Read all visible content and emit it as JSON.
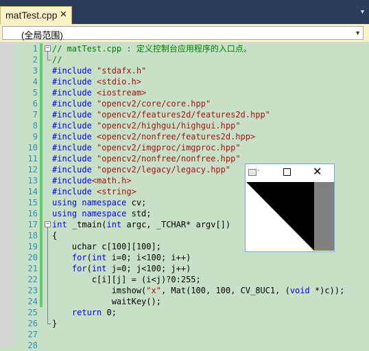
{
  "tab": {
    "title": "matTest.cpp",
    "close_glyph": "✕"
  },
  "scope": {
    "label": "(全局范围)"
  },
  "code_lines": [
    {
      "n": "1",
      "code": [
        [
          "cmt",
          "// matTest.cpp : 定义控制台应用程序的入口点。"
        ]
      ]
    },
    {
      "n": "2",
      "code": [
        [
          "cmt",
          "//"
        ]
      ]
    },
    {
      "n": "3",
      "code": [
        [
          "pp",
          "#include "
        ],
        [
          "str",
          "\"stdafx.h\""
        ]
      ]
    },
    {
      "n": "4",
      "code": [
        [
          "pp",
          "#include "
        ],
        [
          "str",
          "<stdio.h>"
        ]
      ]
    },
    {
      "n": "5",
      "code": [
        [
          "pp",
          "#include "
        ],
        [
          "str",
          "<iostream>"
        ]
      ]
    },
    {
      "n": "6",
      "code": [
        [
          "pp",
          "#include "
        ],
        [
          "str",
          "\"opencv2/core/core.hpp\""
        ]
      ]
    },
    {
      "n": "7",
      "code": [
        [
          "pp",
          "#include "
        ],
        [
          "str",
          "\"opencv2/features2d/features2d.hpp\""
        ]
      ]
    },
    {
      "n": "8",
      "code": [
        [
          "pp",
          "#include "
        ],
        [
          "str",
          "\"opencv2/highgui/highgui.hpp\""
        ]
      ]
    },
    {
      "n": "9",
      "code": [
        [
          "pp",
          "#include "
        ],
        [
          "str",
          "<opencv2/nonfree/features2d.hpp>"
        ]
      ]
    },
    {
      "n": "10",
      "code": [
        [
          "pp",
          "#include "
        ],
        [
          "str",
          "\"opencv2/imgproc/imgproc.hpp\""
        ]
      ]
    },
    {
      "n": "11",
      "code": [
        [
          "pp",
          "#include "
        ],
        [
          "str",
          "\"opencv2/nonfree/nonfree.hpp\""
        ]
      ]
    },
    {
      "n": "12",
      "code": [
        [
          "pp",
          "#include "
        ],
        [
          "str",
          "\"opencv2/legacy/legacy.hpp\""
        ]
      ]
    },
    {
      "n": "13",
      "code": [
        [
          "pp",
          "#include"
        ],
        [
          "str",
          "<math.h>"
        ]
      ]
    },
    {
      "n": "14",
      "code": [
        [
          "pp",
          "#include "
        ],
        [
          "str",
          "<string>"
        ]
      ]
    },
    {
      "n": "15",
      "code": [
        [
          "kw",
          "using namespace"
        ],
        [
          "txt",
          " cv;"
        ]
      ]
    },
    {
      "n": "16",
      "code": [
        [
          "kw",
          "using namespace"
        ],
        [
          "txt",
          " std;"
        ]
      ]
    },
    {
      "n": "17",
      "code": [
        [
          "kw",
          "int"
        ],
        [
          "txt",
          " _tmain("
        ],
        [
          "kw",
          "int"
        ],
        [
          "txt",
          " argc, _TCHAR* argv[])"
        ]
      ]
    },
    {
      "n": "18",
      "code": [
        [
          "txt",
          "{"
        ]
      ]
    },
    {
      "n": "19",
      "code": [
        [
          "txt",
          "    uchar c[100][100];"
        ]
      ]
    },
    {
      "n": "20",
      "code": [
        [
          "txt",
          "    "
        ],
        [
          "kw",
          "for"
        ],
        [
          "txt",
          "("
        ],
        [
          "kw",
          "int"
        ],
        [
          "txt",
          " i=0; i<100; i++)"
        ]
      ]
    },
    {
      "n": "21",
      "code": [
        [
          "txt",
          "    "
        ],
        [
          "kw",
          "for"
        ],
        [
          "txt",
          "("
        ],
        [
          "kw",
          "int"
        ],
        [
          "txt",
          " j=0; j<100; j++)"
        ]
      ]
    },
    {
      "n": "22",
      "code": [
        [
          "txt",
          "        c[i][j] = (i<j)?0:255;"
        ]
      ]
    },
    {
      "n": "23",
      "code": [
        [
          "txt",
          "            imshow("
        ],
        [
          "str",
          "\"x\""
        ],
        [
          "txt",
          ", Mat(100, 100, CV_8UC1, ("
        ],
        [
          "kw",
          "void"
        ],
        [
          "txt",
          " *)c));"
        ]
      ]
    },
    {
      "n": "24",
      "code": [
        [
          "txt",
          "            waitKey();"
        ]
      ]
    },
    {
      "n": "25",
      "code": [
        [
          "txt",
          "    "
        ],
        [
          "kw",
          "return"
        ],
        [
          "txt",
          " 0;"
        ]
      ]
    },
    {
      "n": "26",
      "code": [
        [
          "txt",
          "}"
        ]
      ]
    },
    {
      "n": "27",
      "code": []
    },
    {
      "n": "28",
      "code": []
    }
  ],
  "window": {
    "title_dash": "-",
    "close_glyph": "✕"
  },
  "colors": {
    "canvas_black": "#000000",
    "canvas_white": "#ffffff",
    "canvas_gray": "#808080",
    "change_bar": "#5fce6a"
  },
  "icons": [
    "close-icon",
    "chevron-down-icon",
    "maximize-icon",
    "app-icon"
  ]
}
